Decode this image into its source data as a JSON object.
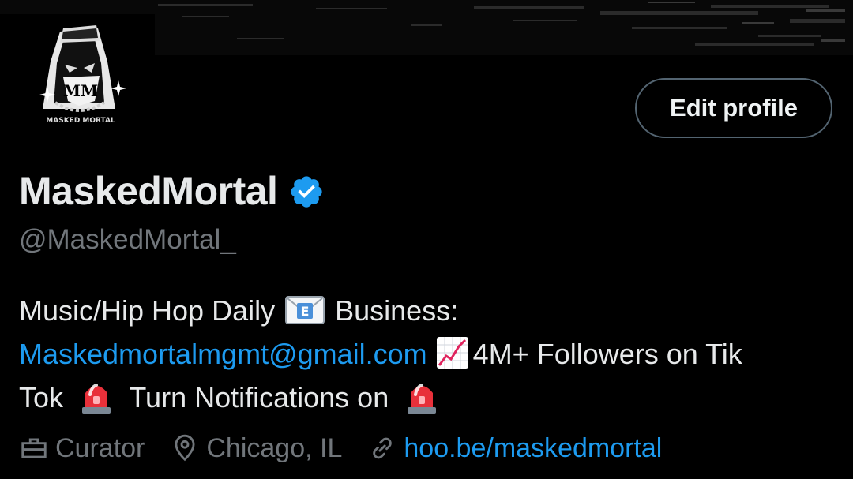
{
  "profile": {
    "display_name": "MaskedMortal",
    "handle": "@MaskedMortal_",
    "edit_button_label": "Edit profile",
    "bio": {
      "line1_text": "Music/Hip Hop Daily",
      "line1_suffix": "Business:",
      "email_link": "Maskedmortalmgmt@gmail.com",
      "followers_text": "4M+ Followers on Tik",
      "line3_prefix": "Tok",
      "notifications_text": "Turn Notifications on"
    },
    "meta": {
      "profession": "Curator",
      "location": "Chicago, IL",
      "website": "hoo.be/maskedmortal"
    },
    "avatar_logo_text": "MASKED MORTAL",
    "avatar_monogram": "MM"
  },
  "icons": {
    "verified": "verified-badge-icon",
    "mail": "envelope-emoji-icon",
    "chart": "chart-increasing-emoji-icon",
    "siren": "siren-emoji-icon",
    "profession": "briefcase-icon",
    "location": "location-pin-icon",
    "website": "link-icon"
  },
  "colors": {
    "background": "#000000",
    "primary_text": "#e7e9ea",
    "secondary_text": "#71767b",
    "link": "#1d9bf0",
    "verified": "#1d9bf0",
    "button_border": "#536471"
  }
}
